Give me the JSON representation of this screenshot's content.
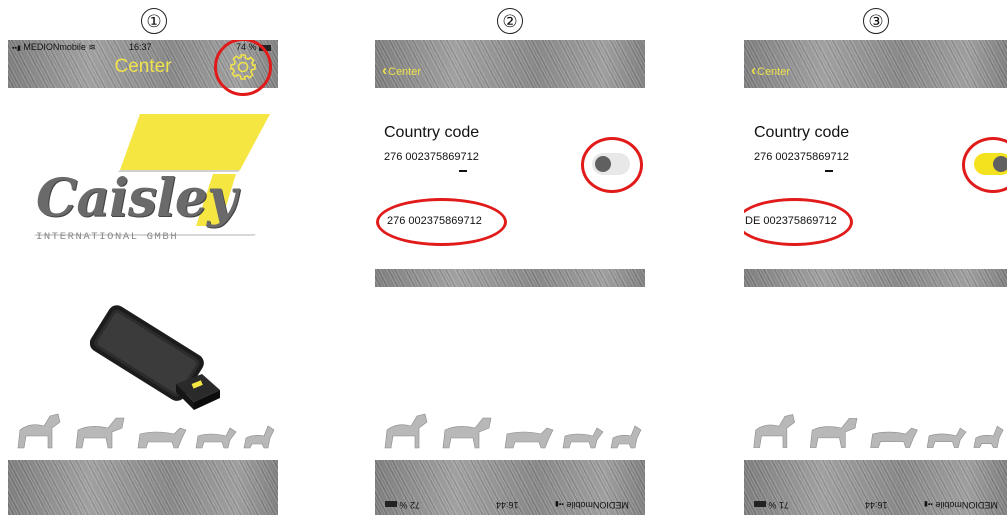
{
  "steps": [
    "①",
    "②",
    "③"
  ],
  "screen1": {
    "status_carrier": "MEDIONmobile",
    "status_time": "16:37",
    "status_battery": "74 %",
    "title": "Center",
    "gear_icon": "gear-icon",
    "logo_text": "Caisley",
    "logo_subtext": "INTERNATIONAL GMBH",
    "brand_yellow": "#f5e642"
  },
  "screen2": {
    "back_label": "Center",
    "country_code_label": "Country code",
    "code_value": "276 002375869712",
    "result_value": "276 002375869712",
    "toggle_on": false,
    "status_carrier": "MEDIONmobile",
    "status_time": "16:44",
    "status_battery": "72 %"
  },
  "screen3": {
    "back_label": "Center",
    "country_code_label": "Country code",
    "code_value": "276 002375869712",
    "result_value": "DE 002375869712",
    "toggle_on": true,
    "status_carrier": "MEDIONmobile",
    "status_time": "16:44",
    "status_battery": "71 %"
  },
  "colors": {
    "highlight_ring": "#e11a1a",
    "accent_yellow": "#f0e24c",
    "toggle_on": "#f5e21f",
    "toggle_off": "#e8e8e8"
  }
}
